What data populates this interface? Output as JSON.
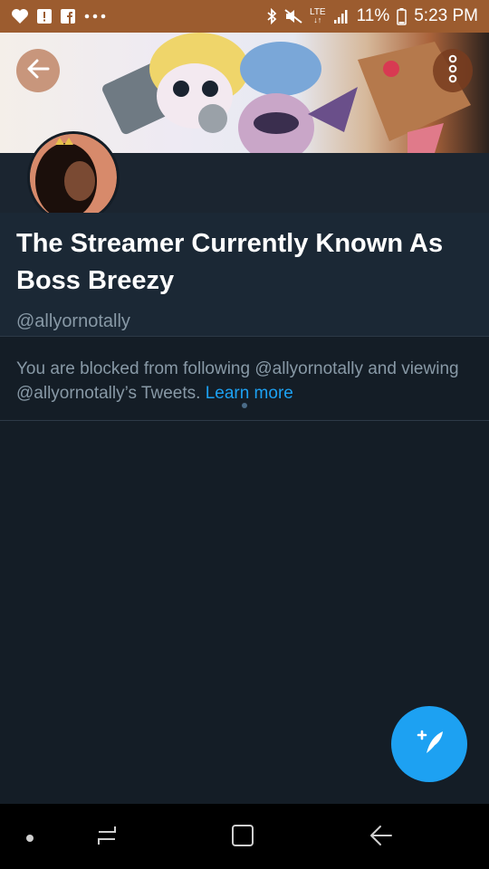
{
  "status_bar": {
    "battery_percent": "11%",
    "time": "5:23 PM",
    "network": "LTE",
    "left_icons": [
      "heart-icon",
      "alert-icon",
      "facebook-icon",
      "more-dots-icon"
    ],
    "right_icons": [
      "bluetooth-icon",
      "mute-icon",
      "lte-icon",
      "signal-icon",
      "battery-icon"
    ]
  },
  "header": {
    "back_icon": "arrow-left-icon",
    "more_icon": "vertical-dots-icon"
  },
  "profile": {
    "display_name": "The Streamer Currently Known As Boss Breezy",
    "handle": "@allyornotally"
  },
  "notice": {
    "text": "You are blocked from following @allyornotally and viewing @allyornotally’s Tweets.",
    "link": "Learn more"
  },
  "fab": {
    "icon": "compose-tweet-icon"
  },
  "nav_bar": {
    "icons": [
      "nav-dot-icon",
      "recent-apps-icon",
      "home-icon",
      "back-icon"
    ]
  },
  "colors": {
    "background": "#141d26",
    "accent": "#1da1f2",
    "status_bar": "#9c5c2f",
    "secondary_text": "#8899a6"
  }
}
